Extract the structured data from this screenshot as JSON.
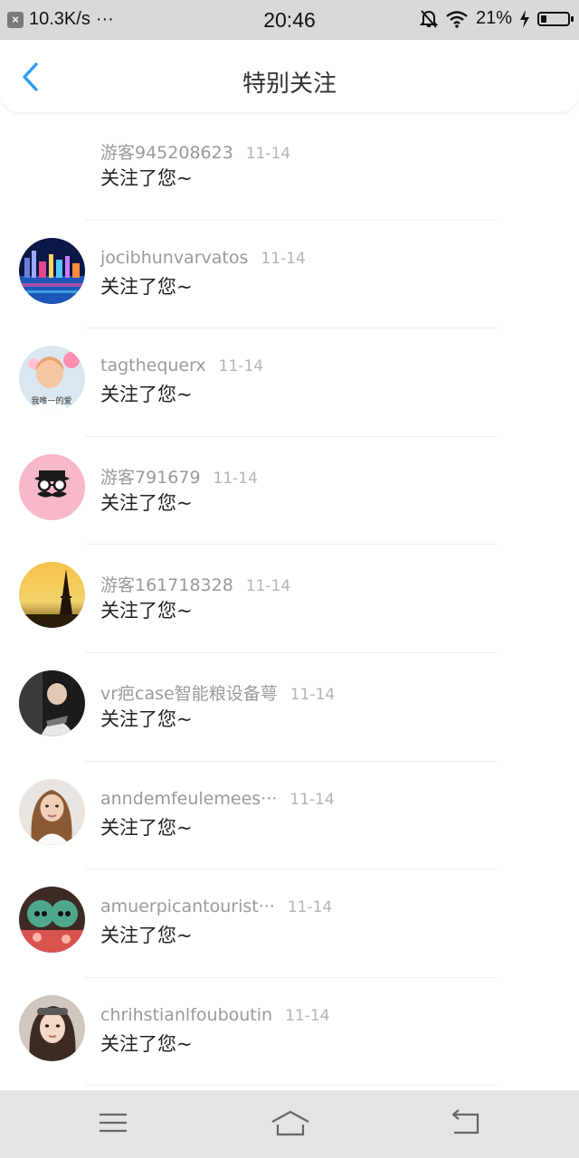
{
  "status_bar": {
    "net_speed": "10.3K/s",
    "dots": "···",
    "time": "20:46",
    "battery_percent_text": "21%",
    "battery_level": 0.21
  },
  "header": {
    "title": "特别关注",
    "back_icon": "chevron-left-icon",
    "accent_color": "#2a9df4"
  },
  "notifications": [
    {
      "username": "游客945208623",
      "date": "11-14",
      "message": "关注了您~",
      "avatar": "none"
    },
    {
      "username": "jocibhunvarvatos",
      "date": "11-14",
      "message": "关注了您~",
      "avatar": "night-city"
    },
    {
      "username": "tagthequerx",
      "date": "11-14",
      "message": "关注了您~",
      "avatar": "girl-photo",
      "avatar_caption": "我唯一的爱"
    },
    {
      "username": "游客791679",
      "date": "11-14",
      "message": "关注了您~",
      "avatar": "mustache-cartoon"
    },
    {
      "username": "游客161718328",
      "date": "11-14",
      "message": "关注了您~",
      "avatar": "eiffel-tower-sunset"
    },
    {
      "username": "vr疤case智能粮设备萼",
      "date": "11-14",
      "message": "关注了您~",
      "avatar": "person-dark"
    },
    {
      "username": "anndemfeulemees···",
      "date": "11-14",
      "message": "关注了您~",
      "avatar": "woman-portrait"
    },
    {
      "username": "amuerpicantourist···",
      "date": "11-14",
      "message": "关注了您~",
      "avatar": "cartoon-characters"
    },
    {
      "username": "chrihstianlfouboutin",
      "date": "11-14",
      "message": "关注了您~",
      "avatar": "selfie-girl"
    }
  ],
  "nav_bar": {
    "menu_icon": "menu-icon",
    "home_icon": "home-icon",
    "back_icon": "back-icon"
  }
}
